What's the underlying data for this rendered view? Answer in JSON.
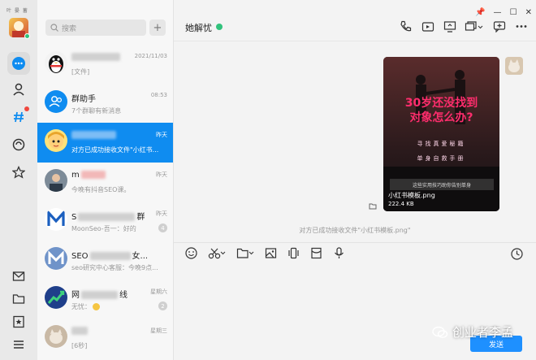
{
  "rail": {
    "tiny_text": "叶 晏 蓄",
    "accent": "#0f8cf0"
  },
  "search": {
    "placeholder": "搜索"
  },
  "add_label": "+",
  "conversations": [
    {
      "name": "",
      "time": "2021/11/03",
      "msg": "[文件]",
      "avatar": "qq-penguin"
    },
    {
      "name": "群助手",
      "time": "08:53",
      "msg": "7个群聊有新消息",
      "avatar": "group-assistant"
    },
    {
      "name": "",
      "time": "昨天",
      "msg": "对方已成功接收文件\"小红书...",
      "avatar": "cartoon-girl",
      "selected": true
    },
    {
      "name": "m",
      "time": "昨天",
      "msg": "今晚有抖音SEO课。",
      "avatar": "person-photo"
    },
    {
      "name": "S",
      "name_suffix": "群",
      "time": "昨天",
      "msg": "MoonSeo-吾一：好的",
      "avatar": "moonseo-logo",
      "mute": "4"
    },
    {
      "name": "SEO",
      "name_suffix": "女...",
      "time": "",
      "msg": "seo研究中心客服：今晚9点...",
      "avatar": "moonseo-logo"
    },
    {
      "name": "网",
      "name_suffix": "线",
      "time": "星期六",
      "msg": "无忧：",
      "avatar": "growth-logo",
      "mute": "2"
    },
    {
      "name": "",
      "time": "星期三",
      "msg": "[6秒]",
      "avatar": "cat-photo"
    }
  ],
  "chat": {
    "title": "她解忧",
    "online_color": "#31c27c",
    "window_controls": [
      "📌",
      "—",
      "☐",
      "✕"
    ],
    "image": {
      "headline1": "30岁还没找到",
      "headline2": "对象怎么办?",
      "sub1": "寻找真爱秘籍",
      "sub2": "单身自救手册",
      "strip": "这些实用技巧助你告别单身",
      "filename": "小红书模板.png",
      "size": "222.4 KB"
    },
    "system_msg": "对方已成功接收文件\"小红书模板.png\"",
    "send_label": "发送",
    "watermark": "创业者李孟"
  }
}
